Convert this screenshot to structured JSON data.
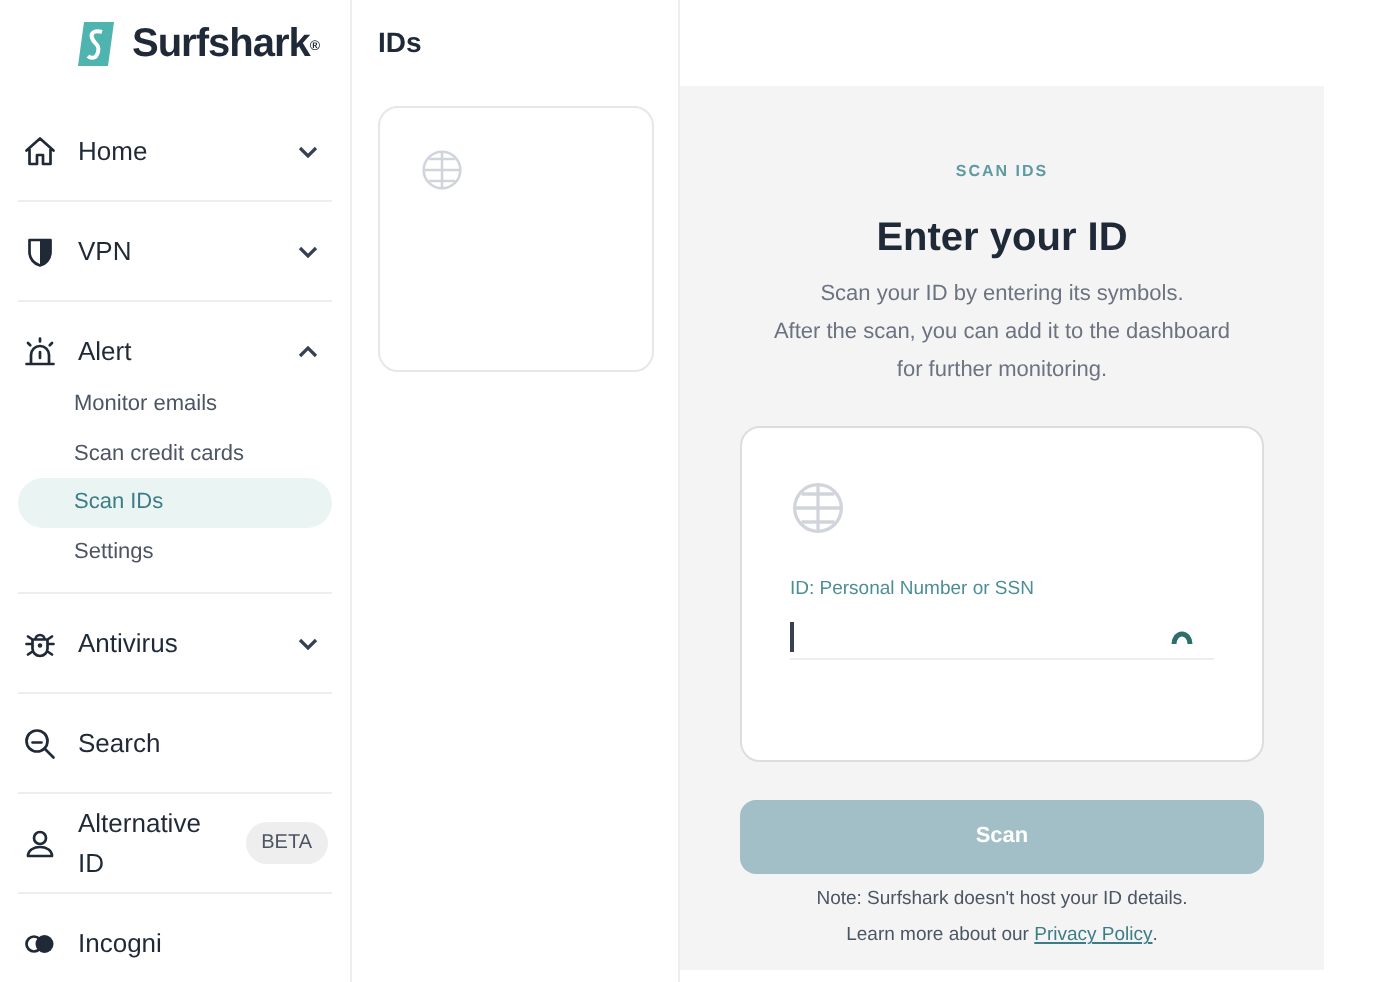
{
  "brand": {
    "name": "Surfshark",
    "mark": "®"
  },
  "sidebar": {
    "items": [
      {
        "label": "Home",
        "expanded": false
      },
      {
        "label": "VPN",
        "expanded": false
      },
      {
        "label": "Alert",
        "expanded": true,
        "children": [
          {
            "label": "Monitor emails",
            "selected": false
          },
          {
            "label": "Scan credit cards",
            "selected": false
          },
          {
            "label": "Scan IDs",
            "selected": true
          },
          {
            "label": "Settings",
            "selected": false
          }
        ]
      },
      {
        "label": "Antivirus",
        "expanded": false
      },
      {
        "label": "Search"
      },
      {
        "label": "Alternative ID",
        "badge": "BETA"
      },
      {
        "label": "Incogni"
      }
    ]
  },
  "ids_panel": {
    "title": "IDs"
  },
  "scan": {
    "eyebrow": "SCAN IDS",
    "title": "Enter your ID",
    "description": [
      "Scan your ID by entering its symbols.",
      "After the scan, you can add it to the dashboard",
      "for further monitoring."
    ],
    "field": {
      "label": "ID: Personal Number or SSN"
    },
    "button": {
      "label": "Scan",
      "disabled": true
    },
    "note": "Note: Surfshark doesn't host your ID details.",
    "note2": "Learn more about our",
    "link": "Privacy Policy",
    "note2_end": "."
  }
}
